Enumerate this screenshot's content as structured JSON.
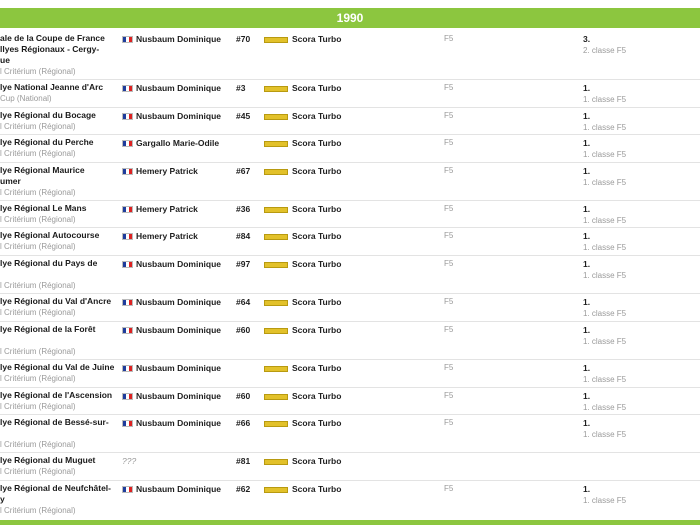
{
  "year": "1990",
  "rows": [
    {
      "event_lines": [
        "ale de la Coupe de France",
        "llyes Régionaux - Cergy-",
        "ue"
      ],
      "category": "l Critérium (Régional)",
      "driver": "Nusbaum Dominique",
      "number": "#70",
      "car": "Scora Turbo",
      "group": "F5",
      "result": "3.",
      "result_class": "2. classe F5"
    },
    {
      "event_lines": [
        "lye National Jeanne d'Arc"
      ],
      "category": "Cup (National)",
      "driver": "Nusbaum Dominique",
      "number": "#3",
      "car": "Scora Turbo",
      "group": "F5",
      "result": "1.",
      "result_class": "1. classe F5"
    },
    {
      "event_lines": [
        "lye Régional du Bocage"
      ],
      "category": "l Critérium (Régional)",
      "driver": "Nusbaum Dominique",
      "number": "#45",
      "car": "Scora Turbo",
      "group": "F5",
      "result": "1.",
      "result_class": "1. classe F5"
    },
    {
      "event_lines": [
        "lye Régional du Perche"
      ],
      "category": "l Critérium (Régional)",
      "driver": "Gargallo Marie-Odile",
      "number": "",
      "car": "Scora Turbo",
      "group": "F5",
      "result": "1.",
      "result_class": "1. classe F5"
    },
    {
      "event_lines": [
        "lye Régional Maurice",
        "umer"
      ],
      "category": "l Critérium (Régional)",
      "driver": "Hemery Patrick",
      "number": "#67",
      "car": "Scora Turbo",
      "group": "F5",
      "result": "1.",
      "result_class": "1. classe F5"
    },
    {
      "event_lines": [
        "lye Régional Le Mans"
      ],
      "category": "l Critérium (Régional)",
      "driver": "Hemery Patrick",
      "number": "#36",
      "car": "Scora Turbo",
      "group": "F5",
      "result": "1.",
      "result_class": "1. classe F5"
    },
    {
      "event_lines": [
        "lye Régional Autocourse"
      ],
      "category": "l Critérium (Régional)",
      "driver": "Hemery Patrick",
      "number": "#84",
      "car": "Scora Turbo",
      "group": "F5",
      "result": "1.",
      "result_class": "1. classe F5"
    },
    {
      "event_lines": [
        "lye Régional du Pays de",
        ""
      ],
      "category": "l Critérium (Régional)",
      "driver": "Nusbaum Dominique",
      "number": "#97",
      "car": "Scora Turbo",
      "group": "F5",
      "result": "1.",
      "result_class": "1. classe F5"
    },
    {
      "event_lines": [
        "lye Régional du Val d'Ancre"
      ],
      "category": "l Critérium (Régional)",
      "driver": "Nusbaum Dominique",
      "number": "#64",
      "car": "Scora Turbo",
      "group": "F5",
      "result": "1.",
      "result_class": "1. classe F5"
    },
    {
      "event_lines": [
        "lye Régional de la Forêt",
        ""
      ],
      "category": "l Critérium (Régional)",
      "driver": "Nusbaum Dominique",
      "number": "#60",
      "car": "Scora Turbo",
      "group": "F5",
      "result": "1.",
      "result_class": "1. classe F5"
    },
    {
      "event_lines": [
        "lye Régional du Val de Juine"
      ],
      "category": "l Critérium (Régional)",
      "driver": "Nusbaum Dominique",
      "number": "",
      "car": "Scora Turbo",
      "group": "F5",
      "result": "1.",
      "result_class": "1. classe F5"
    },
    {
      "event_lines": [
        "lye Régional de l'Ascension"
      ],
      "category": "l Critérium (Régional)",
      "driver": "Nusbaum Dominique",
      "number": "#60",
      "car": "Scora Turbo",
      "group": "F5",
      "result": "1.",
      "result_class": "1. classe F5"
    },
    {
      "event_lines": [
        "lye Régional de Bessé-sur-",
        ""
      ],
      "category": "l Critérium (Régional)",
      "driver": "Nusbaum Dominique",
      "number": "#66",
      "car": "Scora Turbo",
      "group": "F5",
      "result": "1.",
      "result_class": "1. classe F5"
    },
    {
      "event_lines": [
        "lye Régional du Muguet"
      ],
      "category": "l Critérium (Régional)",
      "driver": "???",
      "number": "#81",
      "car": "Scora Turbo",
      "group": "",
      "result": "",
      "result_class": ""
    },
    {
      "event_lines": [
        "lye Régional de Neufchâtel-",
        "y"
      ],
      "category": "l Critérium (Régional)",
      "driver": "Nusbaum Dominique",
      "number": "#62",
      "car": "Scora Turbo",
      "group": "F5",
      "result": "1.",
      "result_class": "1. classe F5"
    }
  ],
  "colors": {
    "accent": "#8cc63f",
    "muted": "#9a9a9a",
    "text": "#1a1a1a"
  },
  "icons": {
    "flag": "france-flag-icon",
    "car_logo": "scora-logo-icon"
  }
}
